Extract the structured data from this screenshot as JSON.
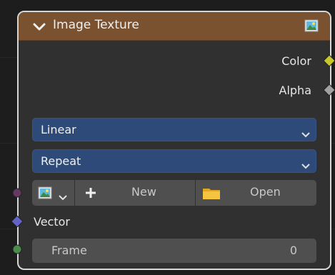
{
  "node": {
    "title": "Image Texture",
    "header_icon": "image-icon",
    "collapse_icon": "chevron-down-icon"
  },
  "outputs": [
    {
      "label": "Color",
      "socket_color": "#c7c729"
    },
    {
      "label": "Alpha",
      "socket_color": "#a1a1a1"
    }
  ],
  "interpolation": {
    "value": "Linear"
  },
  "extension": {
    "value": "Repeat"
  },
  "image_row": {
    "browse_icon": "image-icon",
    "new_label": "New",
    "new_icon": "plus-icon",
    "open_label": "Open",
    "open_icon": "folder-icon"
  },
  "inputs": {
    "image_socket_color": "#633863",
    "vector": {
      "label": "Vector",
      "socket_color": "#6363c7"
    },
    "frame": {
      "label": "Frame",
      "value": "0",
      "socket_color": "#4a8a4a"
    }
  },
  "colors": {
    "header": "#7b5230",
    "node_body": "#303030",
    "dropdown": "#2d4a78",
    "button": "#4f4f4f"
  }
}
